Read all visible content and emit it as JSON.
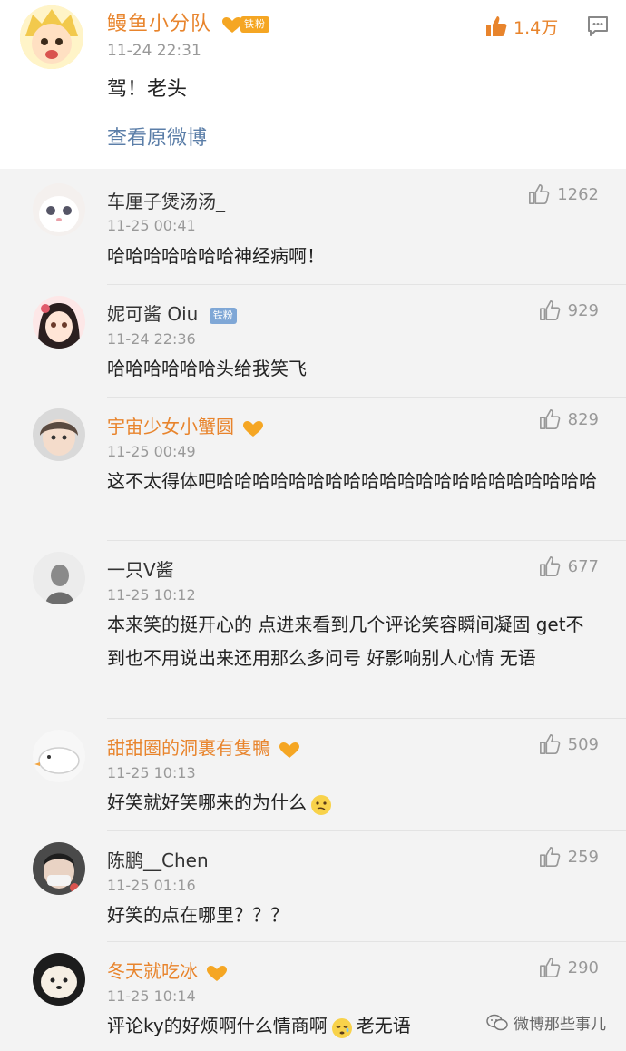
{
  "main_post": {
    "author": "鳗鱼小分队",
    "badge": "铁粉",
    "time": "11-24 22:31",
    "text": "驾！老头",
    "link": "查看原微博",
    "likes": "1.4万"
  },
  "comments": [
    {
      "author": "车厘子煲汤汤_",
      "vip": false,
      "badge": "",
      "time": "11-25 00:41",
      "text": "哈哈哈哈哈哈哈神经病啊！",
      "likes": "1262"
    },
    {
      "author": "妮可酱 Oiu",
      "vip": false,
      "badge": "铁粉",
      "time": "11-24 22:36",
      "text": "哈哈哈哈哈哈头给我笑飞",
      "likes": "929"
    },
    {
      "author": "宇宙少女小蟹圆",
      "vip": true,
      "badge": "",
      "time": "11-25 00:49",
      "text": "这不太得体吧哈哈哈哈哈哈哈哈哈哈哈哈哈哈哈哈哈哈哈哈哈",
      "likes": "829"
    },
    {
      "author": "一只Ⅴ酱",
      "vip": false,
      "badge": "",
      "time": "11-25 10:12",
      "text": "本来笑的挺开心的 点进来看到几个评论笑容瞬间凝固 get不到也不用说出来还用那么多问号 好影响别人心情 无语",
      "likes": "677"
    },
    {
      "author": "甜甜圈的洞裏有隻鴨",
      "vip": true,
      "badge": "",
      "time": "11-25 10:13",
      "text": "好笑就好笑哪来的为什么",
      "likes": "509"
    },
    {
      "author": "陈鹏__Chen",
      "vip": false,
      "badge": "",
      "time": "11-25 01:16",
      "text": "好笑的点在哪里？？？",
      "likes": "259"
    },
    {
      "author": "冬天就吃冰",
      "vip": true,
      "badge": "",
      "time": "11-25 10:14",
      "text": "评论ky的好烦啊什么情商啊",
      "text_after": "老无语",
      "likes": "290"
    }
  ],
  "watermark": "微博那些事儿",
  "colors": {
    "accent": "#e8842c",
    "link": "#5b7ea8",
    "muted": "#999999",
    "background": "#f3f3f3"
  }
}
